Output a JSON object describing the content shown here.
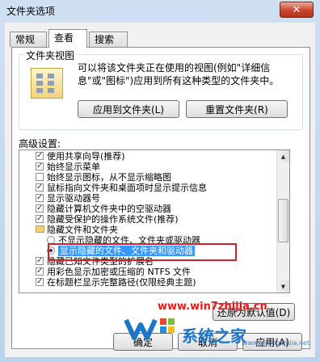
{
  "window": {
    "title": "文件夹选项",
    "close_label": "✕"
  },
  "tabs": [
    {
      "label": "常规",
      "active": false
    },
    {
      "label": "查看",
      "active": true
    },
    {
      "label": "搜索",
      "active": false
    }
  ],
  "folder_views": {
    "legend": "文件夹视图",
    "description": "可以将该文件夹正在使用的视图(例如\"详细信息\"或\"图标\")应用到所有这种类型的文件夹中。",
    "apply_button": "应用到文件夹(L)",
    "reset_button": "重置文件夹(R)"
  },
  "advanced": {
    "label": "高级设置:",
    "items": [
      {
        "type": "checkbox",
        "checked": true,
        "label": "使用共享向导(推荐)"
      },
      {
        "type": "checkbox",
        "checked": true,
        "label": "始终显示菜单"
      },
      {
        "type": "checkbox",
        "checked": false,
        "label": "始终显示图标，从不显示缩略图"
      },
      {
        "type": "checkbox",
        "checked": true,
        "label": "鼠标指向文件夹和桌面项时显示提示信息"
      },
      {
        "type": "checkbox",
        "checked": true,
        "label": "显示驱动器号"
      },
      {
        "type": "checkbox",
        "checked": true,
        "label": "隐藏计算机文件夹中的空驱动器"
      },
      {
        "type": "checkbox",
        "checked": true,
        "label": "隐藏受保护的操作系统文件(推荐)"
      },
      {
        "type": "folder",
        "label": "隐藏文件和文件夹"
      },
      {
        "type": "radio",
        "checked": false,
        "label": "不显示隐藏的文件、文件夹或驱动器"
      },
      {
        "type": "radio",
        "checked": true,
        "label": "显示隐藏的文件、文件夹和驱动器"
      },
      {
        "type": "checkbox",
        "checked": true,
        "label": "隐藏已知文件类型的扩展名"
      },
      {
        "type": "checkbox",
        "checked": true,
        "label": "用彩色显示加密或压缩的 NTFS 文件"
      },
      {
        "type": "checkbox",
        "checked": true,
        "label": "在标题栏显示完整路径(仅限经典主题)"
      }
    ],
    "restore_button": "还原为默认值(D)"
  },
  "bottom_buttons": {
    "ok": "确定",
    "cancel": "取消",
    "apply": "应用(A)"
  },
  "watermark": {
    "url": "www.win7zhijia.cn",
    "brand": "系统之家",
    "sub": "www.xitongzhijia.net"
  }
}
